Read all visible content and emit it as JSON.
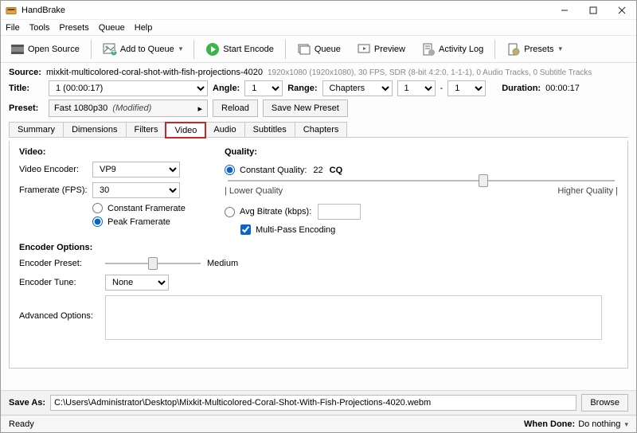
{
  "titlebar": {
    "app_name": "HandBrake"
  },
  "menu": {
    "file": "File",
    "tools": "Tools",
    "presets": "Presets",
    "queue": "Queue",
    "help": "Help"
  },
  "toolbar": {
    "open_source": "Open Source",
    "add_to_queue": "Add to Queue",
    "start_encode": "Start Encode",
    "queue": "Queue",
    "preview": "Preview",
    "activity_log": "Activity Log",
    "presets": "Presets"
  },
  "source": {
    "label": "Source:",
    "name": "mixkit-multicolored-coral-shot-with-fish-projections-4020",
    "meta": "1920x1080 (1920x1080), 30 FPS, SDR (8-bit 4:2:0, 1-1-1), 0 Audio Tracks, 0 Subtitle Tracks"
  },
  "title": {
    "label": "Title:",
    "value": "1  (00:00:17)",
    "angle_label": "Angle:",
    "angle_value": "1",
    "range_label": "Range:",
    "range_mode": "Chapters",
    "range_from": "1",
    "range_sep": "-",
    "range_to": "1",
    "duration_label": "Duration:",
    "duration_value": "00:00:17"
  },
  "preset": {
    "label": "Preset:",
    "name": "Fast 1080p30",
    "modified": "(Modified)",
    "reload": "Reload",
    "save_new": "Save New Preset"
  },
  "tabs": {
    "summary": "Summary",
    "dimensions": "Dimensions",
    "filters": "Filters",
    "video": "Video",
    "audio": "Audio",
    "subtitles": "Subtitles",
    "chapters": "Chapters"
  },
  "video": {
    "section": "Video:",
    "encoder_label": "Video Encoder:",
    "encoder_value": "VP9",
    "fps_label": "Framerate (FPS):",
    "fps_value": "30",
    "cfr": "Constant Framerate",
    "pfr": "Peak Framerate"
  },
  "quality": {
    "section": "Quality:",
    "cq_label": "Constant Quality:",
    "cq_value": "22",
    "cq_suffix": "CQ",
    "low": "| Lower Quality",
    "high": "Higher Quality |",
    "avg_label": "Avg Bitrate (kbps):",
    "avg_value": "",
    "multipass": "Multi-Pass Encoding",
    "slider_percent": 66
  },
  "encoder_options": {
    "section": "Encoder Options:",
    "preset_label": "Encoder Preset:",
    "preset_value": "Medium",
    "preset_slider_percent": 50,
    "tune_label": "Encoder Tune:",
    "tune_value": "None",
    "advanced_label": "Advanced Options:"
  },
  "saveas": {
    "label": "Save As:",
    "value": "C:\\Users\\Administrator\\Desktop\\Mixkit-Multicolored-Coral-Shot-With-Fish-Projections-4020.webm",
    "browse": "Browse"
  },
  "status": {
    "ready": "Ready",
    "when_done_label": "When Done:",
    "when_done_value": "Do nothing"
  }
}
